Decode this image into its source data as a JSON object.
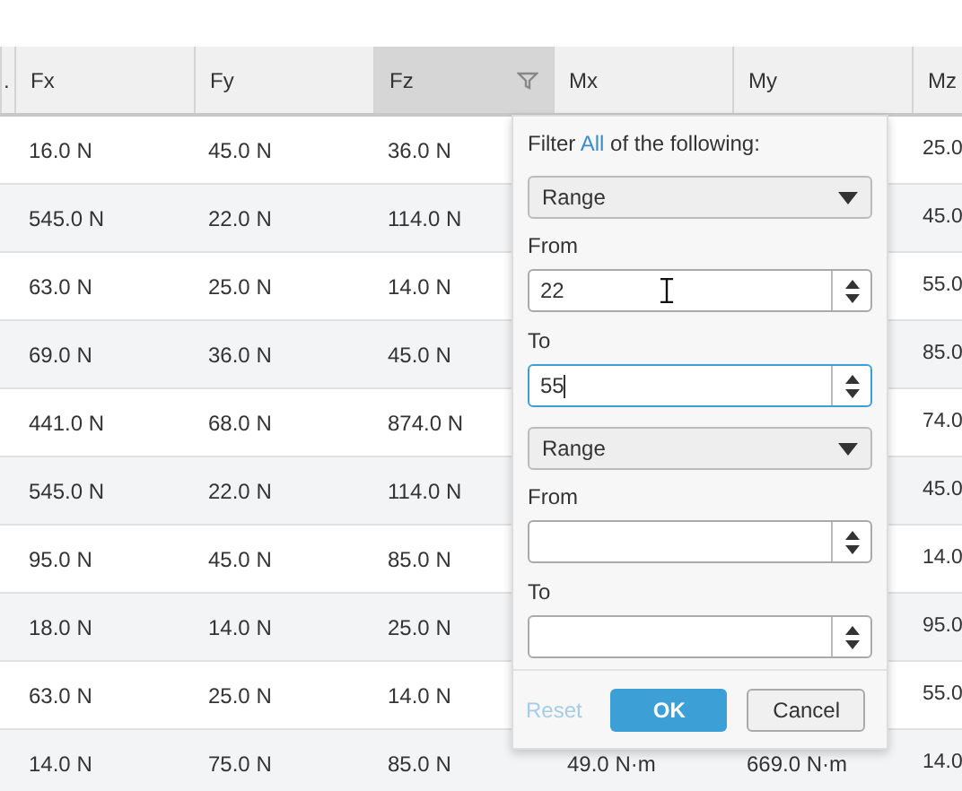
{
  "table": {
    "columns": [
      {
        "label": ".",
        "filter_open": false
      },
      {
        "label": "Fx",
        "filter_open": false
      },
      {
        "label": "Fy",
        "filter_open": false
      },
      {
        "label": "Fz",
        "filter_open": true
      },
      {
        "label": "Mx",
        "filter_open": false
      },
      {
        "label": "My",
        "filter_open": false
      },
      {
        "label": "Mz",
        "filter_open": false
      }
    ],
    "rows": [
      {
        "cells": {
          "fx": "16.0 N",
          "fy": "45.0 N",
          "fz": "36.0 N",
          "mz": "25.0"
        }
      },
      {
        "cells": {
          "fx": "545.0 N",
          "fy": "22.0 N",
          "fz": "114.0 N",
          "mz": "45.0"
        }
      },
      {
        "cells": {
          "fx": "63.0 N",
          "fy": "25.0 N",
          "fz": "14.0 N",
          "mz": "55.0"
        }
      },
      {
        "cells": {
          "fx": "69.0 N",
          "fy": "36.0 N",
          "fz": "45.0 N",
          "mz": "85.0"
        }
      },
      {
        "cells": {
          "fx": "441.0 N",
          "fy": "68.0 N",
          "fz": "874.0 N",
          "mz": "74.0"
        }
      },
      {
        "cells": {
          "fx": "545.0 N",
          "fy": "22.0 N",
          "fz": "114.0 N",
          "mz": "45.0"
        }
      },
      {
        "cells": {
          "fx": "95.0 N",
          "fy": "45.0 N",
          "fz": "85.0 N",
          "mz": "14.0"
        }
      },
      {
        "cells": {
          "fx": "18.0 N",
          "fy": "14.0 N",
          "fz": "25.0 N",
          "mz": "95.0"
        }
      },
      {
        "cells": {
          "fx": "63.0 N",
          "fy": "25.0 N",
          "fz": "14.0 N",
          "mz": "55.0"
        }
      },
      {
        "cells": {
          "fx": "14.0 N",
          "fy": "75.0 N",
          "fz": "85.0 N",
          "mx": "49.0 N·m",
          "my": "669.0 N·m",
          "mz": "14.0"
        }
      }
    ]
  },
  "filter_popup": {
    "heading_before": "Filter",
    "heading_link": "All",
    "heading_after": "of the following:",
    "conditions": [
      {
        "operator": "Range",
        "from_label": "From",
        "from": {
          "value": "22",
          "focused": false
        },
        "to_label": "To",
        "to": {
          "value": "55",
          "focused": true
        }
      },
      {
        "operator": "Range",
        "from_label": "From",
        "from": {
          "focused": false
        },
        "to_label": "To",
        "to": {
          "focused": false
        }
      }
    ],
    "reset": {
      "label": "Reset",
      "disabled": true
    },
    "ok": {
      "label": "OK"
    },
    "cancel": {
      "label": "Cancel"
    }
  }
}
